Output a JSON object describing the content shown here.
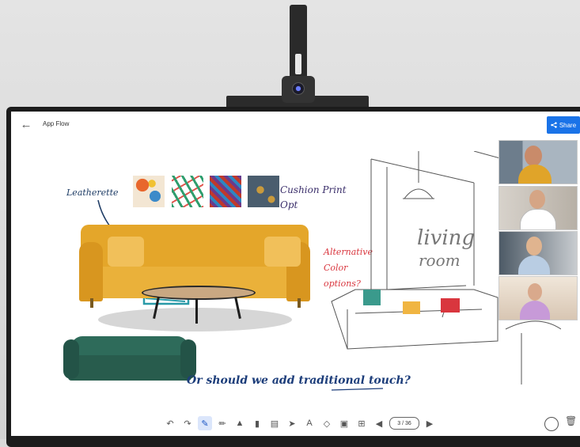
{
  "header": {
    "title": "App Flow",
    "back_icon": "arrow-left-icon",
    "share_label": "Share",
    "share_icon": "share-icon"
  },
  "canvas": {
    "annotations": {
      "leatherette": "Leatherette",
      "cushion_line1": "Cushion Print",
      "cushion_line2": "Opt",
      "alternative_line1": "Alternative",
      "alternative_line2": "Color",
      "alternative_line3": "options?",
      "question": "Or should we add traditional touch?"
    },
    "sketch_sign_line1": "living",
    "sketch_sign_line2": "room"
  },
  "toolbar": {
    "page_indicator": "3 / 36",
    "tools": [
      "undo-icon",
      "redo-icon",
      "pen-icon",
      "marker-icon",
      "highlighter-icon",
      "eraser-icon",
      "ruler-icon",
      "pointer-icon",
      "text-icon",
      "shapes-icon",
      "image-icon",
      "add-icon"
    ]
  },
  "colors": {
    "accent": "#1a73e8",
    "leatherette_ink": "#1f3d66",
    "alt_ink": "#d9363e",
    "question_ink": "#1c3d7a"
  }
}
